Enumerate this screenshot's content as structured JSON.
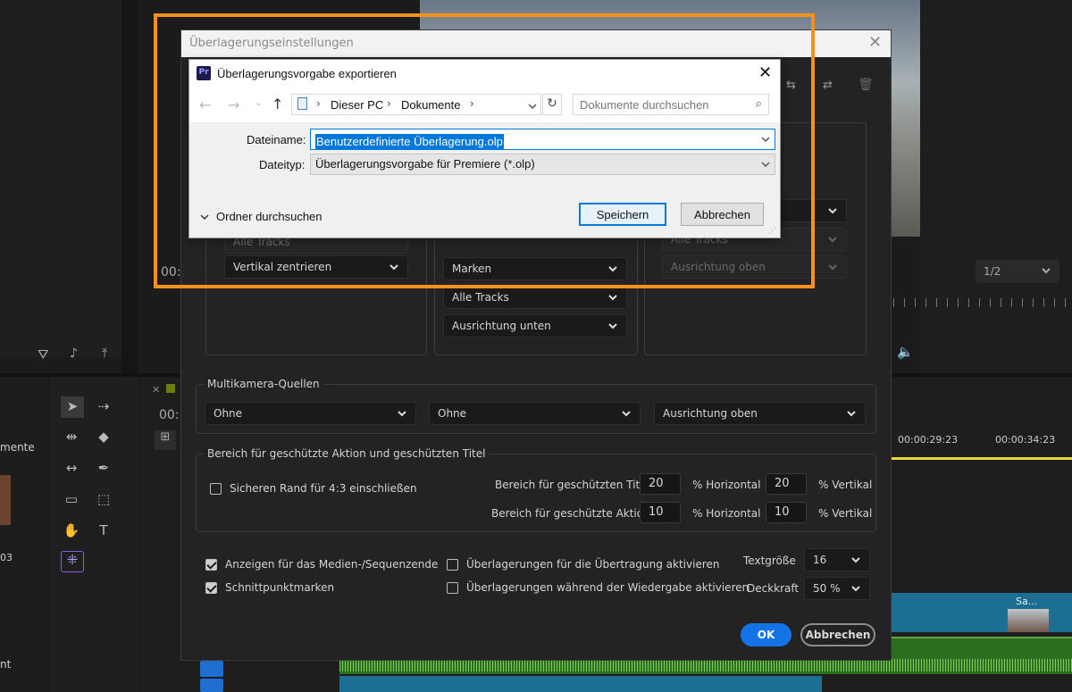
{
  "background": {
    "left_label_mente": "mente",
    "left_label_03": "03",
    "left_label_nt": "nt",
    "timecode_top": "00:",
    "timecode_mid": "00:",
    "zoom_select": "1/2",
    "ruler_tc1": "00:00:29:23",
    "ruler_tc2": "00:00:34:23",
    "clip_label": "Sa..."
  },
  "overlay_dialog": {
    "title": "Überlagerungseinstellungen",
    "bg_dropdowns": {
      "col1_tracks": "Alle Tracks",
      "col1_align": "Vertikal zentrieren",
      "col2_markers": "Marken",
      "col2_tracks": "Alle Tracks",
      "col2_align": "Ausrichtung unten",
      "col3_tracks": "Alle Tracks",
      "col3_align": "Ausrichtung oben"
    },
    "multicam": {
      "title": "Multikamera-Quellen",
      "dd1": "Ohne",
      "dd2": "Ohne",
      "dd3": "Ausrichtung oben"
    },
    "safe": {
      "title": "Bereich für geschützte Aktion und geschützten Titel",
      "checkbox_label": "Sicheren Rand für 4:3 einschließen",
      "title_label": "Bereich für geschützten Titel",
      "action_label": "Bereich für geschützte Aktion",
      "title_h": "20",
      "title_v": "20",
      "action_h": "10",
      "action_v": "10",
      "h_unit": "% Horizontal",
      "v_unit": "% Vertikal"
    },
    "options": {
      "cb1": "Anzeigen für das Medien-/Sequenzende",
      "cb2": "Schnittpunktmarken",
      "cb3": "Überlagerungen für die Übertragung aktivieren",
      "cb4": "Überlagerungen während der Wiedergabe aktivieren",
      "text_size_label": "Textgröße",
      "text_size": "16",
      "opacity_label": "Deckkraft",
      "opacity": "50 %"
    },
    "ok": "OK",
    "cancel": "Abbrechen"
  },
  "export_dialog": {
    "app_icon": "Pr",
    "title": "Überlagerungsvorgabe exportieren",
    "breadcrumb": [
      "Dieser PC",
      "Dokumente"
    ],
    "search_placeholder": "Dokumente durchsuchen",
    "filename_label": "Dateiname:",
    "filename": "Benutzerdefinierte Überlagerung.olp",
    "filetype_label": "Dateityp:",
    "filetype": "Überlagerungsvorgabe für Premiere (*.olp)",
    "browse": "Ordner durchsuchen",
    "save": "Speichern",
    "cancel": "Abbrechen"
  },
  "colors": {
    "highlight_frame": "#f5921e",
    "ok_blue": "#1473e6",
    "selection": "#0078d7"
  }
}
